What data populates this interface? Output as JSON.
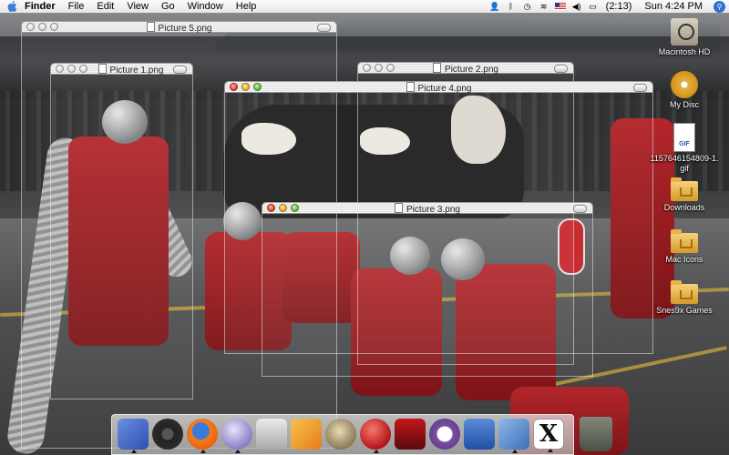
{
  "menubar": {
    "app": "Finder",
    "menus": [
      "File",
      "Edit",
      "View",
      "Go",
      "Window",
      "Help"
    ],
    "battery": "(2:13)",
    "clock": "Sun 4:24 PM"
  },
  "windows": {
    "picture5": "Picture 5.png",
    "picture1": "Picture 1.png",
    "picture2": "Picture 2.png",
    "picture4": "Picture 4.png",
    "picture3": "Picture 3.png"
  },
  "desktop_icons": [
    {
      "label": "Macintosh HD",
      "icon": "hard-drive-icon"
    },
    {
      "label": "My Disc",
      "icon": "disc-icon"
    },
    {
      "label": "1157646154809-1.gif",
      "icon": "gif-file-icon"
    },
    {
      "label": "Downloads",
      "icon": "folder-icon"
    },
    {
      "label": "Mac Icons",
      "icon": "folder-icon"
    },
    {
      "label": "Snes9x Games",
      "icon": "folder-icon"
    }
  ],
  "dock": [
    {
      "icon": "finder-icon",
      "running": true
    },
    {
      "icon": "dashboard-icon",
      "running": false
    },
    {
      "icon": "firefox-icon",
      "running": true
    },
    {
      "icon": "itunes-icon",
      "running": true
    },
    {
      "icon": "preview-icon",
      "running": false
    },
    {
      "icon": "photos-icon",
      "running": false
    },
    {
      "icon": "gimp-icon",
      "running": false
    },
    {
      "icon": "flash-player-icon",
      "running": true
    },
    {
      "icon": "photo-booth-icon",
      "running": false
    },
    {
      "icon": "transmission-icon",
      "running": false
    },
    {
      "icon": "word-icon",
      "running": false
    },
    {
      "icon": "iphoto-icon",
      "running": true
    },
    {
      "icon": "x11-icon",
      "running": true
    },
    {
      "icon": "trash-icon",
      "running": false
    }
  ],
  "colors": {
    "menubar": "#e9e9e9",
    "accent": "#2f6ed1",
    "close": "#e3362b",
    "minimize": "#e8a51c",
    "zoom": "#55b22e"
  }
}
